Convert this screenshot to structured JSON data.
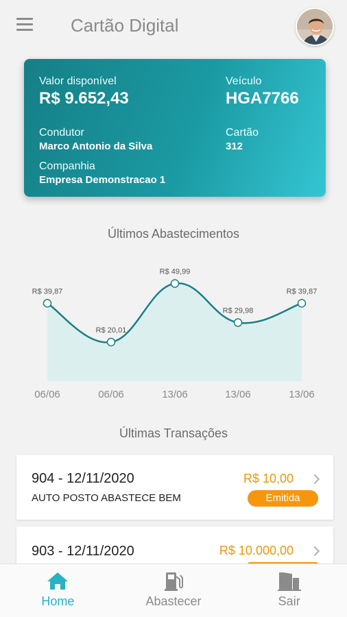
{
  "header": {
    "title": "Cartão Digital"
  },
  "card": {
    "available_label": "Valor disponível",
    "available_value": "R$ 9.652,43",
    "vehicle_label": "Veículo",
    "vehicle_value": "HGA7766",
    "driver_label": "Condutor",
    "driver_value": "Marco Antonio da Silva",
    "card_label": "Cartão",
    "card_value": "312",
    "company_label": "Companhia",
    "company_value": "Empresa Demonstracao 1"
  },
  "chart_section": {
    "title": "Últimos Abastecimentos"
  },
  "chart_data": {
    "type": "area",
    "categories": [
      "06/06",
      "06/06",
      "13/06",
      "13/06",
      "13/06"
    ],
    "values": [
      39.87,
      20.01,
      49.99,
      29.98,
      39.87
    ],
    "data_labels": [
      "R$ 39,87",
      "R$ 20,01",
      "R$ 49,99",
      "R$ 29,98",
      "R$ 39,87"
    ],
    "title": "",
    "xlabel": "",
    "ylabel": "",
    "ylim": [
      0,
      60
    ],
    "grid": false,
    "line_color": "#1a7f86",
    "fill_color": "#dcefef"
  },
  "transactions_section": {
    "title": "Últimas Transações"
  },
  "transactions": [
    {
      "title": "904 - 12/11/2020",
      "station": "AUTO POSTO ABASTECE BEM",
      "amount": "R$ 10,00",
      "status": "Emitida"
    },
    {
      "title": "903 - 12/11/2020",
      "station": "",
      "amount": "R$ 10.000,00",
      "status": ""
    }
  ],
  "tabs": [
    {
      "label": "Home",
      "icon": "home-icon",
      "active": true
    },
    {
      "label": "Abastecer",
      "icon": "fuel-pump-icon",
      "active": false
    },
    {
      "label": "Sair",
      "icon": "exit-door-icon",
      "active": false
    }
  ],
  "colors": {
    "accent": "#27b3c1",
    "card_gradient_start": "#157f86",
    "card_gradient_end": "#34c5d2",
    "amount": "#f2950a",
    "badge": "#f7960e"
  }
}
